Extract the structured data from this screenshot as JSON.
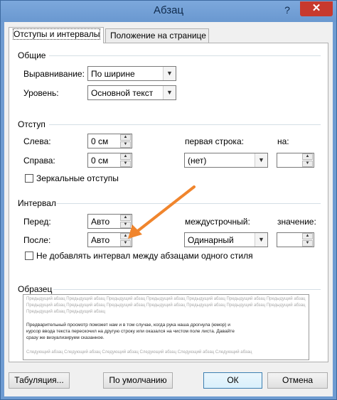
{
  "window": {
    "title": "Абзац",
    "help": "?",
    "close": "✕"
  },
  "tabs": [
    {
      "label": "Отступы и интервалы",
      "active": true
    },
    {
      "label": "Положение на странице",
      "active": false
    }
  ],
  "general": {
    "title": "Общие",
    "alignment_label": "Выравнивание:",
    "alignment_value": "По ширине",
    "level_label": "Уровень:",
    "level_value": "Основной текст"
  },
  "indent": {
    "title": "Отступ",
    "left_label": "Слева:",
    "left_value": "0 см",
    "right_label": "Справа:",
    "right_value": "0 см",
    "first_line_label": "первая строка:",
    "first_line_value": "(нет)",
    "by_label": "на:",
    "by_value": "",
    "mirror_label": "Зеркальные отступы"
  },
  "spacing": {
    "title": "Интервал",
    "before_label": "Перед:",
    "before_value": "Авто",
    "after_label": "После:",
    "after_value": "Авто",
    "line_label": "междустрочный:",
    "line_value": "Одинарный",
    "at_label": "значение:",
    "at_value": "",
    "no_space_label": "Не добавлять интервал между абзацами одного стиля"
  },
  "preview": {
    "title": "Образец",
    "prev_lines": [
      "Предыдущий абзац Предыдущий абзац Предыдущий абзац Предыдущий абзац Предыдущий абзац Предыдущий абзац Предыдущий абзац",
      "Предыдущий абзац Предыдущий абзац Предыдущий абзац Предыдущий абзац Предыдущий абзац Предыдущий абзац Предыдущий абзац",
      "Предыдущий абзац Предыдущий абзац"
    ],
    "sample_lines": [
      "Предварительный просмотр поможет нам и в том случае, когда рука наша дрогнула (юмор) и",
      "курсор ввода текста перескочил на другую строку или оказался на чистом поле листа. Давайте",
      "сразу же визуализируем сказанное."
    ],
    "next_lines": [
      "Следующий абзац Следующий абзац Следующий абзац Следующий абзац Следующий абзац Следующий абзац"
    ]
  },
  "buttons": {
    "tabs": "Табуляция...",
    "default": "По умолчанию",
    "ok": "ОК",
    "cancel": "Отмена"
  },
  "colors": {
    "arrow": "#f0852d",
    "window_frame": "#6e9bd1",
    "close_button": "#c7392d"
  }
}
